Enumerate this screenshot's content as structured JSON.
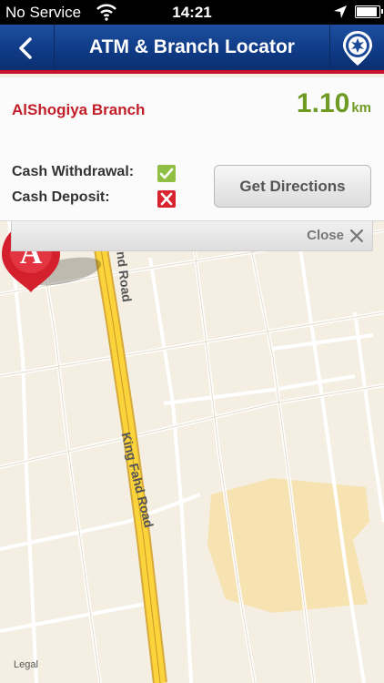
{
  "status_bar": {
    "carrier": "No Service",
    "time": "14:21"
  },
  "nav": {
    "title": "ATM & Branch Locator",
    "colors": {
      "bar": "#0f3a84",
      "accent": "#c8102e"
    }
  },
  "branch": {
    "name": "AlShogiya Branch",
    "distance": "1.10",
    "distance_unit": "km"
  },
  "services": [
    {
      "label": "Cash Withdrawal:",
      "available": true,
      "icon": "check-icon"
    },
    {
      "label": "Cash Deposit:",
      "available": false,
      "icon": "cross-icon"
    }
  ],
  "buttons": {
    "directions": "Get Directions",
    "close": "Close"
  },
  "map": {
    "road_label_upper": "nd Road",
    "road_label_lower": "King Fahd Road",
    "legal": "Legal",
    "marker_letter": "A"
  }
}
